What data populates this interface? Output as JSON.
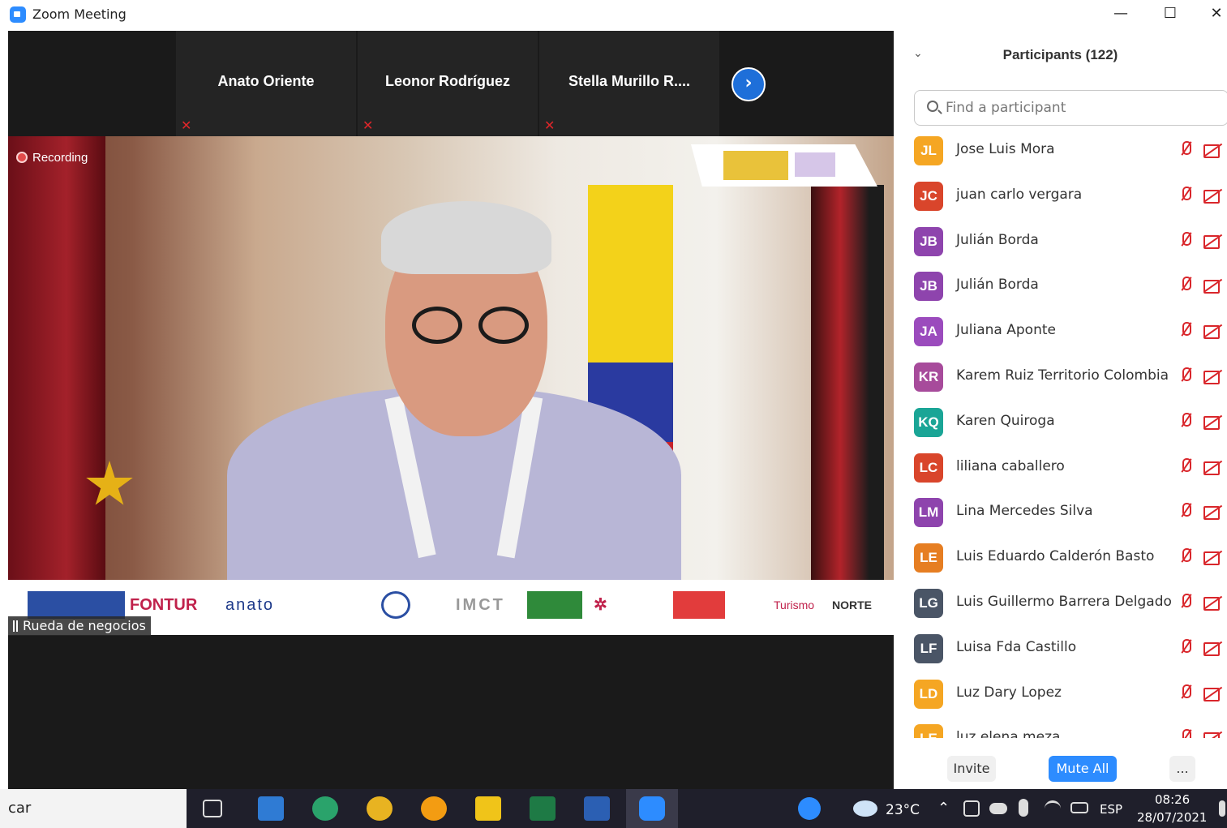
{
  "window": {
    "title": "Zoom Meeting",
    "minimize_glyph": "—",
    "maximize_glyph": "☐",
    "close_glyph": "✕"
  },
  "gallery": {
    "tiles": [
      {
        "name": "Anato Oriente"
      },
      {
        "name": "Leonor Rodríguez"
      },
      {
        "name": "Stella  Murillo  R...."
      }
    ],
    "next_glyph": "›"
  },
  "main_video": {
    "recording_label": "Recording",
    "caption": "Rueda de negocios",
    "sponsor_logos": [
      "FONTUR",
      "anato",
      "IMCT",
      "Turismo",
      "NORTE"
    ]
  },
  "participants": {
    "header": "Participants (122)",
    "search_placeholder": "Find a participant",
    "list": [
      {
        "initials": "JL",
        "name": "Jose Luis Mora",
        "color": "#f5a623"
      },
      {
        "initials": "JC",
        "name": "juan carlo vergara",
        "color": "#d9452b"
      },
      {
        "initials": "JB",
        "name": "Julián Borda",
        "color": "#8e44ad"
      },
      {
        "initials": "JB",
        "name": "Julián Borda",
        "color": "#8e44ad"
      },
      {
        "initials": "JA",
        "name": "Juliana Aponte",
        "color": "#9b4bbd"
      },
      {
        "initials": "KR",
        "name": "Karem Ruiz Territorio Colombia",
        "color": "#a74b9b"
      },
      {
        "initials": "KQ",
        "name": "Karen Quiroga",
        "color": "#1aa596"
      },
      {
        "initials": "LC",
        "name": "liliana caballero",
        "color": "#d9452b"
      },
      {
        "initials": "LM",
        "name": "Lina Mercedes Silva",
        "color": "#8e44ad"
      },
      {
        "initials": "LE",
        "name": "Luis Eduardo Calderón Basto",
        "color": "#e67e22"
      },
      {
        "initials": "LG",
        "name": "Luis Guillermo Barrera Delgado",
        "color": "#4a5566"
      },
      {
        "initials": "LF",
        "name": "Luisa Fda Castillo",
        "color": "#4a5566"
      },
      {
        "initials": "LD",
        "name": "Luz Dary Lopez",
        "color": "#f5a623"
      },
      {
        "initials": "LE",
        "name": "luz elena meza",
        "color": "#f5a623"
      }
    ],
    "invite_label": "Invite",
    "mute_all_label": "Mute All",
    "more_label": "..."
  },
  "taskbar": {
    "search_text": "car",
    "weather": "23°C",
    "language": "ESP",
    "time": "08:26",
    "date": "28/07/2021"
  },
  "colors": {
    "zoom_blue": "#2d8cff",
    "mute_red": "#d9262b",
    "dark_bg": "#1a1a1a"
  }
}
